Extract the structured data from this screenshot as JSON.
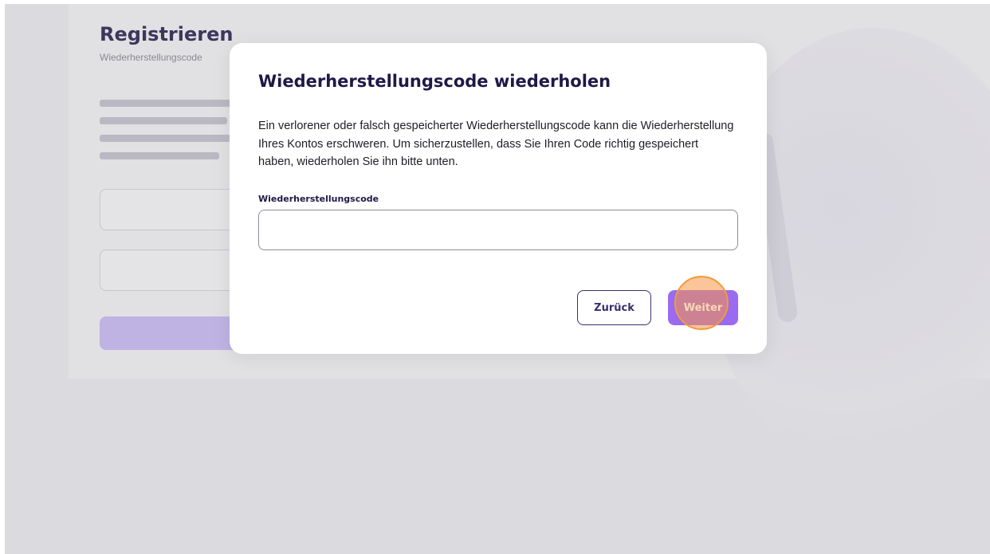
{
  "background": {
    "title": "Registrieren",
    "subtitle": "Wiederherstellungscode",
    "option_1": "",
    "option_2": "",
    "footer": ""
  },
  "modal": {
    "title": "Wiederherstellungscode wiederholen",
    "description": "Ein verlorener oder falsch gespeicherter Wiederherstellungscode kann die Wiederherstellung Ihres Kontos erschweren. Um sicherzustellen, dass Sie Ihren Code richtig gespeichert haben, wiederholen Sie ihn bitte unten.",
    "field": {
      "label": "Wiederherstellungscode",
      "value": "",
      "placeholder": ""
    },
    "buttons": {
      "back": "Zurück",
      "next": "Weiter"
    }
  },
  "colors": {
    "primary": "#9a6bf0",
    "title": "#201845",
    "click_marker": "#f29a3e"
  }
}
